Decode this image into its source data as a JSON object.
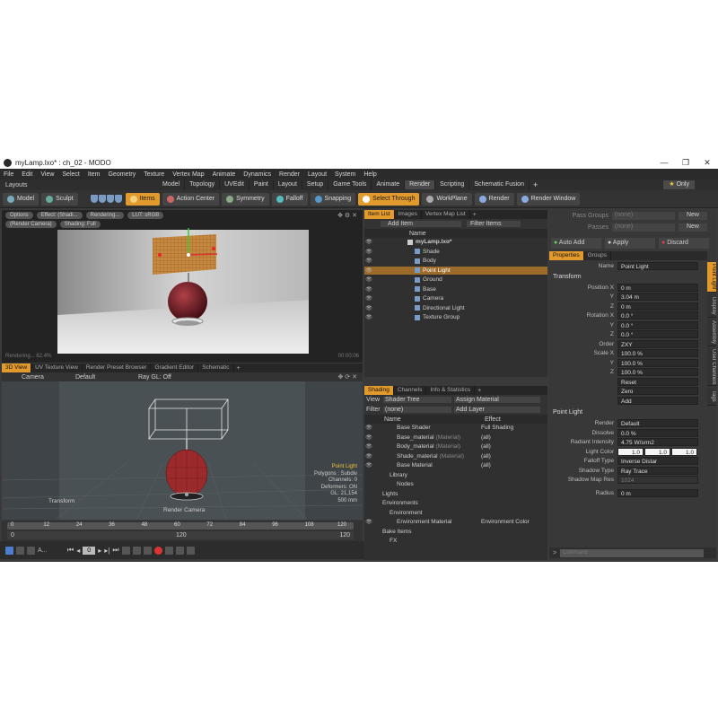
{
  "window": {
    "title": "myLamp.lxo* : ch_02 - MODO",
    "controls": [
      "—",
      "❐",
      "✕"
    ]
  },
  "menu": [
    "File",
    "Edit",
    "View",
    "Select",
    "Item",
    "Geometry",
    "Texture",
    "Vertex Map",
    "Animate",
    "Dynamics",
    "Render",
    "Layout",
    "System",
    "Help"
  ],
  "layoutbar": {
    "label": "Layouts",
    "tabs": [
      "Model",
      "Topology",
      "UVEdit",
      "Paint",
      "Layout",
      "Setup",
      "Game Tools",
      "Animate",
      "Render",
      "Scripting",
      "Schematic Fusion"
    ],
    "active_tab": "Render",
    "only": "Only"
  },
  "toolbar": {
    "mode": "Model",
    "sculpt": "Sculpt",
    "items": "Items",
    "action_center": "Action Center",
    "symmetry": "Symmetry",
    "falloff": "Falloff",
    "snapping": "Snapping",
    "select_through": "Select Through",
    "workplane": "WorkPlane",
    "render": "Render",
    "render_window": "Render Window"
  },
  "preview": {
    "chips": [
      "Options",
      "Effect: (Shadi...",
      "Rendering...",
      "LUT: sRGB"
    ],
    "chips2": [
      "(Render Camera)",
      "Shading: Full"
    ],
    "status_left": "Rendering... 62.4%",
    "status_right": "00:00:06"
  },
  "view3d": {
    "tabs": [
      "3D View",
      "UV Texture View",
      "Render Preset Browser",
      "Gradient Editor",
      "Schematic"
    ],
    "camera": "Camera",
    "default": "Default",
    "raygl": "Ray GL: Off",
    "info": [
      "Point Light",
      "Polygons : Subdiv",
      "Channels: 0",
      "Deformers: ON",
      "GL: 21,154",
      "500 mm"
    ],
    "transform": "Transform",
    "render_camera": "Render Camera"
  },
  "timeline": {
    "ticks": [
      "0",
      "12",
      "24",
      "36",
      "48",
      "60",
      "72",
      "84",
      "96",
      "108",
      "120"
    ],
    "range": [
      "0",
      "120",
      "120"
    ],
    "frame": "0"
  },
  "itemlist": {
    "tabs": [
      "Item List",
      "Images",
      "Vertex Map List"
    ],
    "add_item": "Add Item",
    "filter_items": "Filter Items",
    "col_name": "Name",
    "items": [
      {
        "name": "myLamp.lxo*",
        "indent": 1
      },
      {
        "name": "Shade",
        "indent": 2
      },
      {
        "name": "Body",
        "indent": 2
      },
      {
        "name": "Point Light",
        "indent": 2
      },
      {
        "name": "Ground",
        "indent": 2
      },
      {
        "name": "Base",
        "indent": 2
      },
      {
        "name": "Camera",
        "indent": 2
      },
      {
        "name": "Directional Light",
        "indent": 2
      },
      {
        "name": "Texture Group",
        "indent": 2
      }
    ],
    "selected_index": 3
  },
  "shading": {
    "tabs": [
      "Shading",
      "Channels",
      "Info & Statistics"
    ],
    "view_label": "View",
    "view_value": "Shader Tree",
    "assign_material": "Assign Material",
    "filter_label": "Filter",
    "filter_value": "(none)",
    "add_layer": "Add Layer",
    "col_name": "Name",
    "col_effect": "Effect",
    "rows": [
      {
        "name": "Base Shader",
        "tag": "",
        "effect": "Full Shading",
        "indent": 2
      },
      {
        "name": "Base_material",
        "tag": "(Material)",
        "effect": "(all)",
        "indent": 2
      },
      {
        "name": "Body_material",
        "tag": "(Material)",
        "effect": "(all)",
        "indent": 2
      },
      {
        "name": "Shade_material",
        "tag": "(Material)",
        "effect": "(all)",
        "indent": 2
      },
      {
        "name": "Base Material",
        "tag": "",
        "effect": "(all)",
        "indent": 2
      },
      {
        "name": "Library",
        "tag": "",
        "effect": "",
        "indent": 1
      },
      {
        "name": "Nodes",
        "tag": "",
        "effect": "",
        "indent": 2
      },
      {
        "name": "Lights",
        "tag": "",
        "effect": "",
        "indent": 0
      },
      {
        "name": "Environments",
        "tag": "",
        "effect": "",
        "indent": 0
      },
      {
        "name": "Environment",
        "tag": "",
        "effect": "",
        "indent": 1
      },
      {
        "name": "Environment Material",
        "tag": "",
        "effect": "Environment Color",
        "indent": 2
      },
      {
        "name": "Bake Items",
        "tag": "",
        "effect": "",
        "indent": 0
      },
      {
        "name": "FX",
        "tag": "",
        "effect": "",
        "indent": 1
      }
    ]
  },
  "properties": {
    "pass_groups_label": "Pass Groups",
    "pass_groups_value": "(none)",
    "passes_label": "Passes",
    "passes_value": "(none)",
    "new": "New",
    "auto_add": "Auto Add",
    "apply": "Apply",
    "discard": "Discard",
    "tabs": [
      "Properties",
      "Groups"
    ],
    "name_label": "Name",
    "name_value": "Point Light",
    "transform_section": "Transform",
    "position_label": "Position X",
    "pos": [
      "0 m",
      "3.04 m",
      "0 m"
    ],
    "rotation_label": "Rotation X",
    "rot": [
      "0.0 °",
      "0.0 °",
      "0.0 °"
    ],
    "order_label": "Order",
    "order_value": "ZXY",
    "scale_label": "Scale X",
    "scale": [
      "100.0 %",
      "100.0 %",
      "100.0 %"
    ],
    "y": "Y",
    "z": "Z",
    "reset": "Reset",
    "zero": "Zero",
    "add": "Add",
    "pl_section": "Point Light",
    "render_label": "Render",
    "render_value": "Default",
    "dissolve_label": "Dissolve",
    "dissolve_value": "0.0 %",
    "radiant_label": "Radiant Intensity",
    "radiant_value": "4.75 W/srm2",
    "color_label": "Light Color",
    "color_values": [
      "1.0",
      "1.0",
      "1.0"
    ],
    "falloff_label": "Falloff Type",
    "falloff_value": "Inverse Distar",
    "shadow_label": "Shadow Type",
    "shadow_value": "Ray Trace",
    "shadowres_label": "Shadow Map Res",
    "shadowres_value": "1024",
    "radius_label": "Radius",
    "radius_value": "0 m",
    "side_tabs": [
      "Point Light",
      "Display",
      "Assembly",
      "User Channels",
      "Tags"
    ],
    "command_placeholder": "Command"
  },
  "colors": {
    "accent": "#e39a2c",
    "panel": "#2d2d2d",
    "lampshade": "#c6883e",
    "lampbody": "#7a1e22"
  }
}
